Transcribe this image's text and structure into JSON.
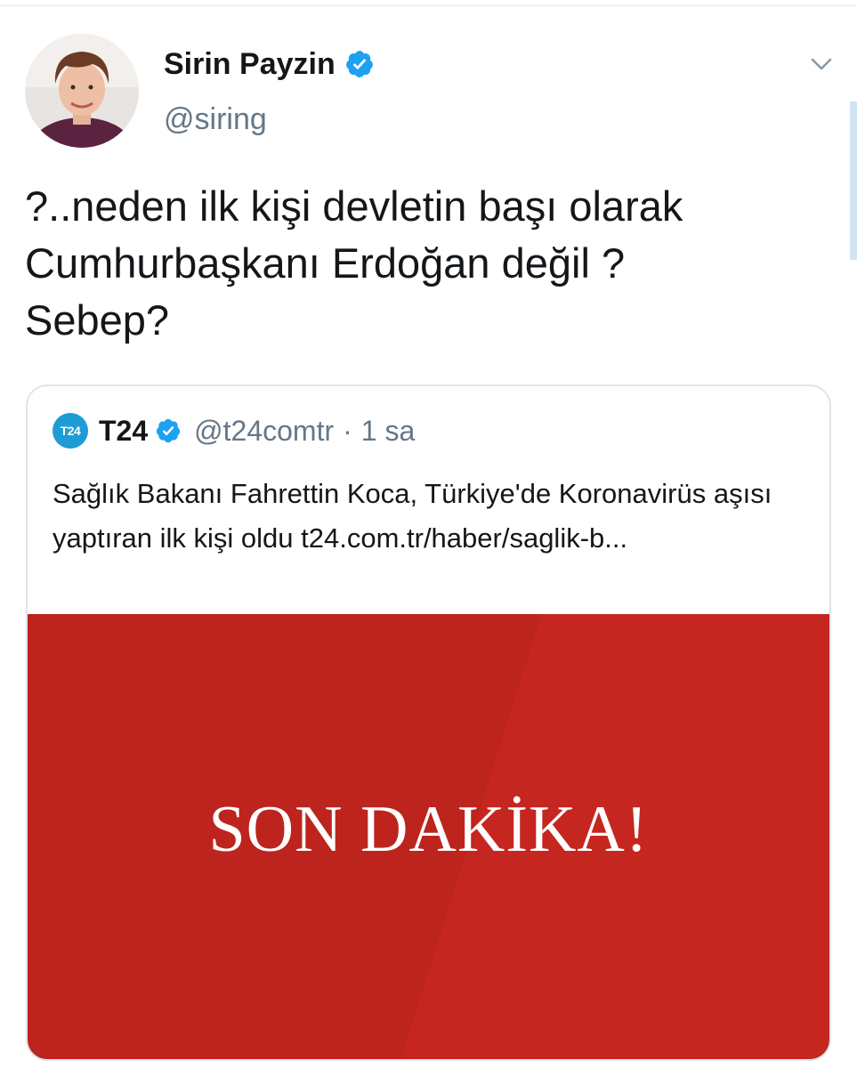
{
  "tweet": {
    "author": {
      "display_name": "Sirin Payzin",
      "handle": "@siring",
      "verified": true,
      "avatar_icon": "profile-photo"
    },
    "text": "?..neden ilk kişi devletin başı olarak\nCumhurbaşkanı Erdoğan değil ?\nSebep?",
    "menu_icon": "chevron-down-icon"
  },
  "quoted_tweet": {
    "author": {
      "display_name": "T24",
      "handle": "@t24comtr",
      "verified": true,
      "logo_text": "T24"
    },
    "separator": "·",
    "time": "1 sa",
    "text": "Sağlık Bakanı Fahrettin Koca, Türkiye'de Koronavirüs aşısı yaptıran ilk kişi oldu t24.com.tr/haber/saglik-b...",
    "media": {
      "caption": "SON DAKİKA!",
      "background_color": "#c4261f"
    }
  },
  "colors": {
    "verified_blue": "#1da1f2",
    "secondary_text": "#657786",
    "border": "#dfe6eb"
  }
}
